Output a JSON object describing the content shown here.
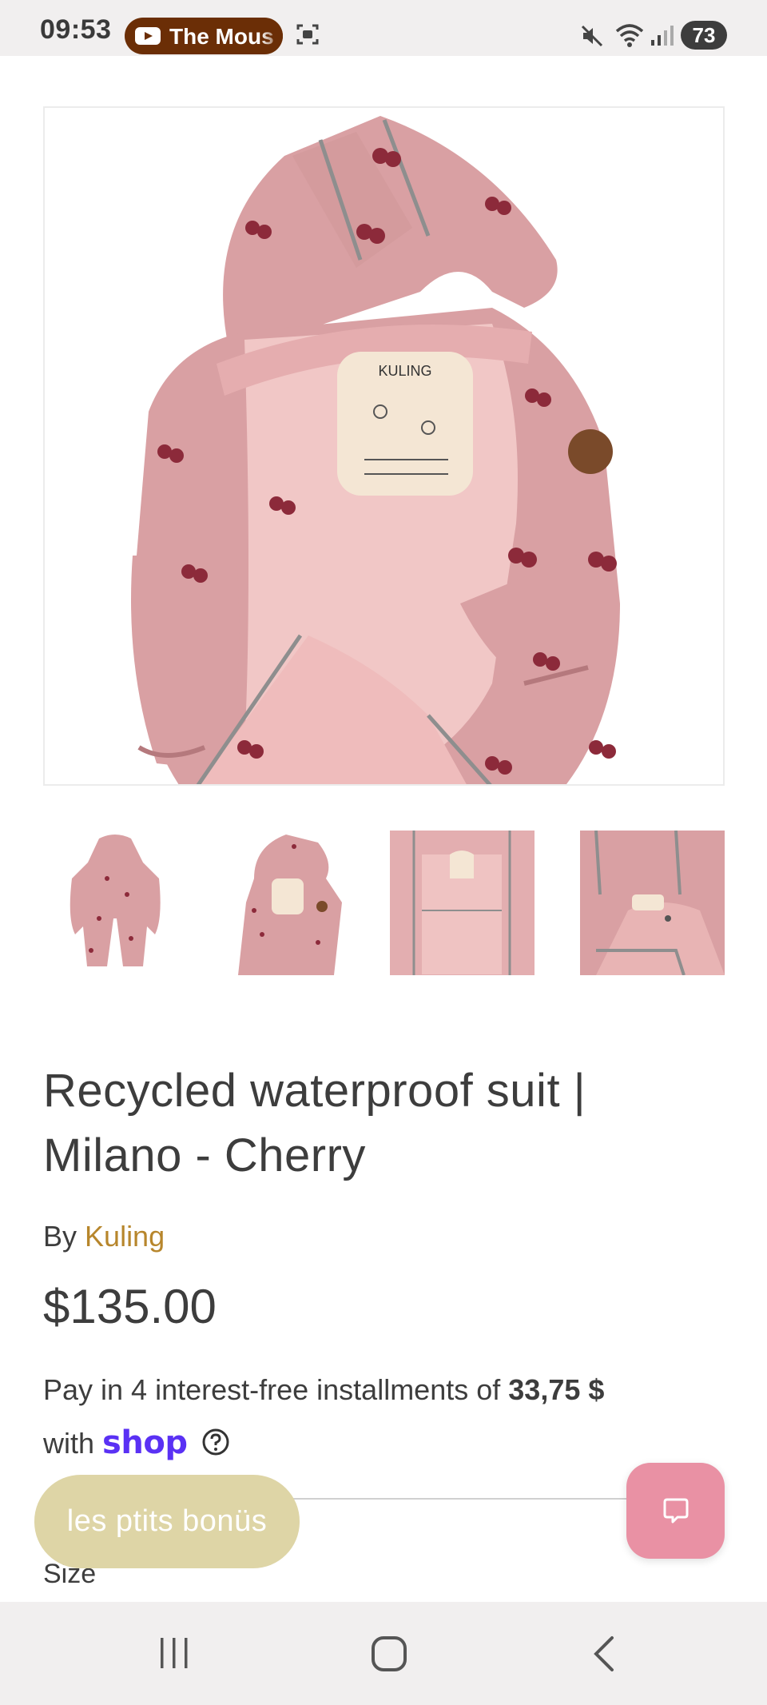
{
  "status_bar": {
    "time": "09:53",
    "media_title": "The Mous",
    "battery": "73"
  },
  "product": {
    "image_brand_label": "KULING",
    "title": "Recycled waterproof suit | Milano - Cherry",
    "vendor_prefix": "By",
    "vendor_name": "Kuling",
    "price": "$135.00",
    "installments_prefix": "Pay in 4 interest-free installments of",
    "installments_amount": "33,75 $",
    "installments_with": "with",
    "installments_provider": "shop",
    "size_label": "Size"
  },
  "rewards": {
    "label": "les ptits bonüs"
  },
  "colors": {
    "accent_vendor": "#b7862c",
    "rewards_bg": "#ded5a6",
    "chat_bg": "#e991a4",
    "shop_purple": "#5a31f4",
    "product_pink": "#d9a0a3"
  }
}
